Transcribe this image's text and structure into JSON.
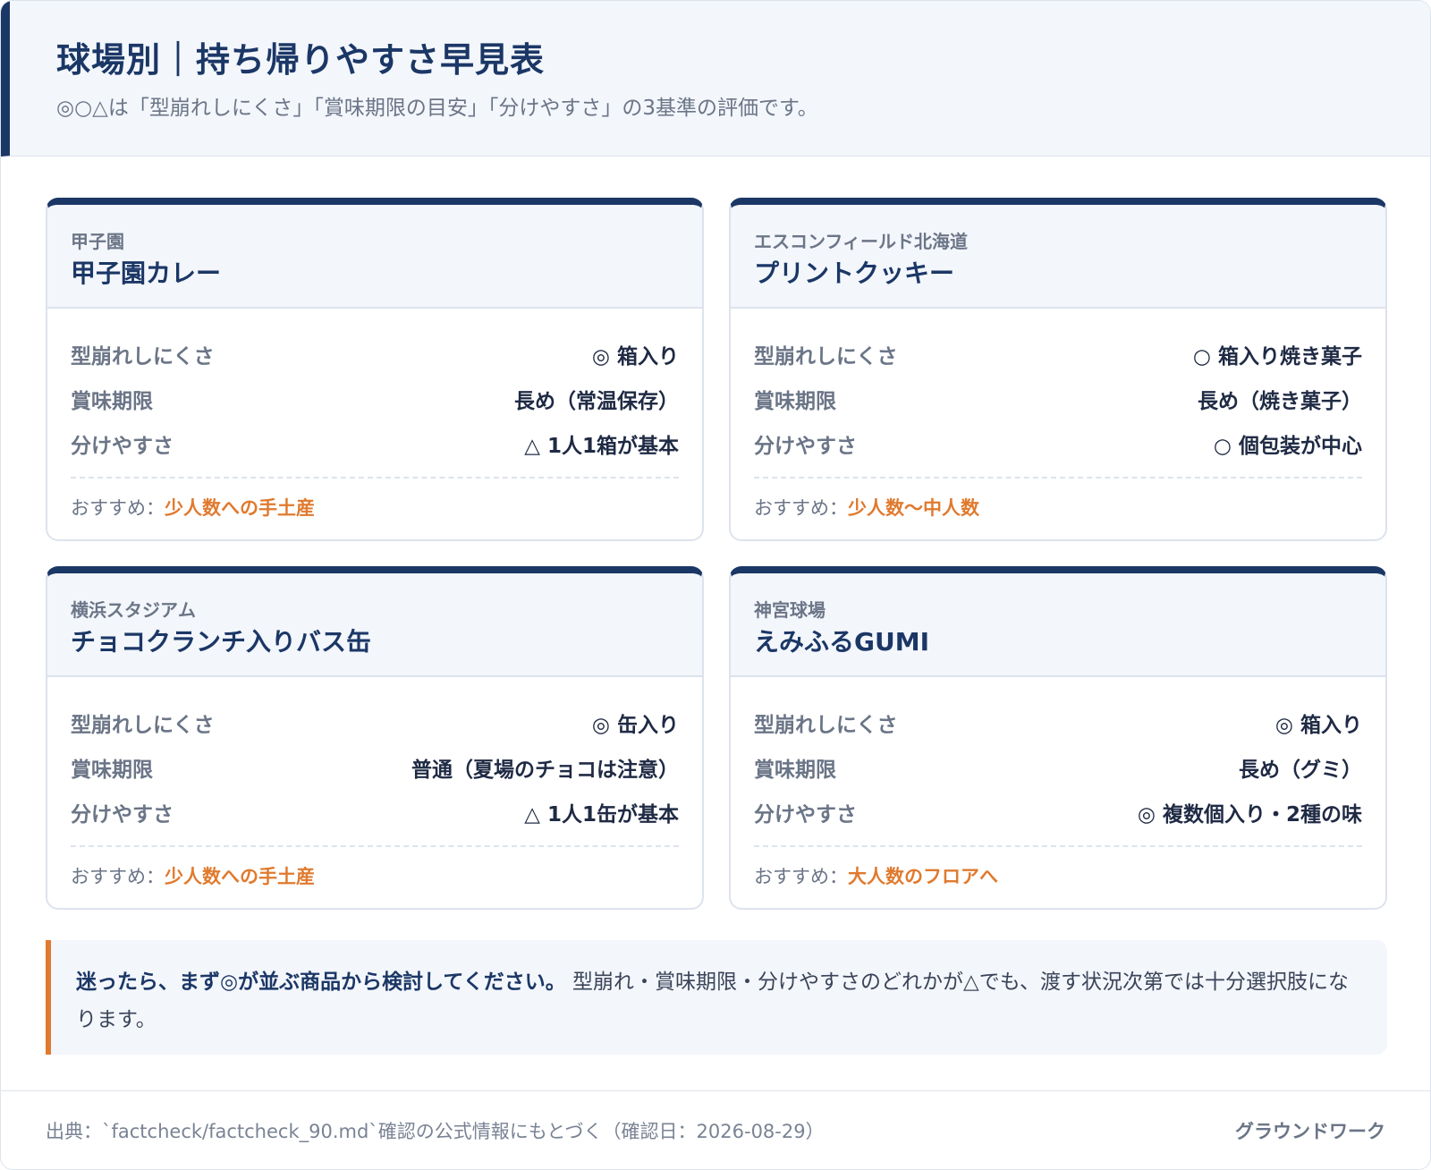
{
  "header": {
    "title": "球場別｜持ち帰りやすさ早見表",
    "subtitle": "◎○△は「型崩れしにくさ」「賞味期限の目安」「分けやすさ」の3基準の評価です。"
  },
  "recommend_prefix": "おすすめ：",
  "cards": [
    {
      "venue": "甲子園",
      "product": "甲子園カレー",
      "rows": [
        {
          "label": "型崩れしにくさ",
          "value": "◎ 箱入り"
        },
        {
          "label": "賞味期限",
          "value": "長め（常温保存）"
        },
        {
          "label": "分けやすさ",
          "value": "△ 1人1箱が基本"
        }
      ],
      "recommend": "少人数への手土産"
    },
    {
      "venue": "エスコンフィールド北海道",
      "product": "プリントクッキー",
      "rows": [
        {
          "label": "型崩れしにくさ",
          "value": "○ 箱入り焼き菓子"
        },
        {
          "label": "賞味期限",
          "value": "長め（焼き菓子）"
        },
        {
          "label": "分けやすさ",
          "value": "○ 個包装が中心"
        }
      ],
      "recommend": "少人数〜中人数"
    },
    {
      "venue": "横浜スタジアム",
      "product": "チョコクランチ入りバス缶",
      "rows": [
        {
          "label": "型崩れしにくさ",
          "value": "◎ 缶入り"
        },
        {
          "label": "賞味期限",
          "value": "普通（夏場のチョコは注意）"
        },
        {
          "label": "分けやすさ",
          "value": "△ 1人1缶が基本"
        }
      ],
      "recommend": "少人数への手土産"
    },
    {
      "venue": "神宮球場",
      "product": "えみふるGUMI",
      "rows": [
        {
          "label": "型崩れしにくさ",
          "value": "◎ 箱入り"
        },
        {
          "label": "賞味期限",
          "value": "長め（グミ）"
        },
        {
          "label": "分けやすさ",
          "value": "◎ 複数個入り・2種の味"
        }
      ],
      "recommend": "大人数のフロアへ"
    }
  ],
  "note": {
    "strong": "迷ったら、まず◎が並ぶ商品から検討してください。",
    "text": " 型崩れ・賞味期限・分けやすさのどれかが△でも、渡す状況次第では十分選択肢になります。"
  },
  "footer": {
    "source": "出典：`factcheck/factcheck_90.md`確認の公式情報にもとづく（確認日：2026-08-29）",
    "brand": "グラウンドワーク"
  },
  "colors": {
    "navy": "#1b3766",
    "accent_orange": "#e07a2e",
    "muted_text": "#6b7587",
    "panel_bg": "#f3f6fb"
  }
}
